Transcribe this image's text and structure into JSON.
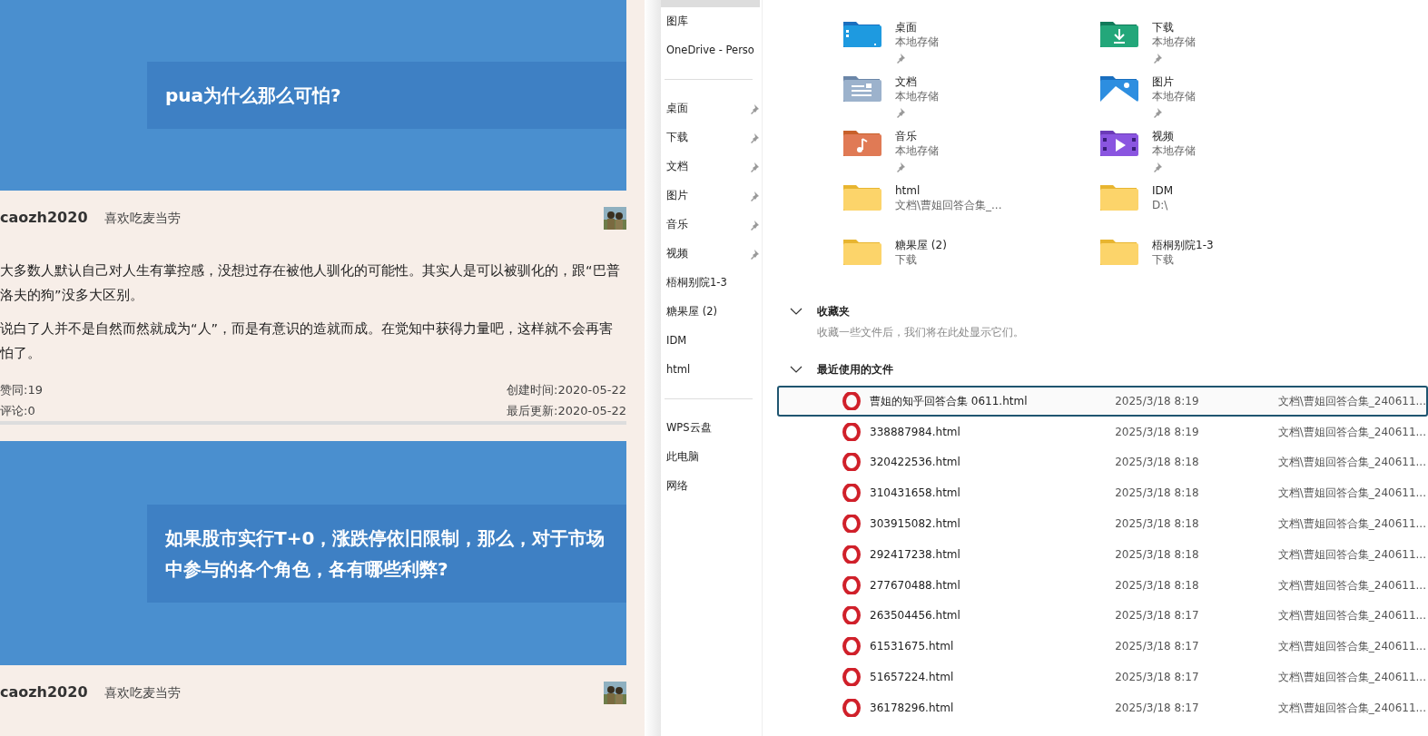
{
  "reader": {
    "posts": [
      {
        "question": "pua为什么那么可怕?",
        "author": {
          "name": "caozh2020",
          "signature": "喜欢吃麦当劳"
        },
        "paragraphs": [
          "大多数人默认自己对人生有掌控感，没想过存在被他人驯化的可能性。其实人是可以被驯化的，跟“巴普洛夫的狗”没多大区别。",
          "说白了人并不是自然而然就成为“人”，而是有意识的造就而成。在觉知中获得力量吧，这样就不会再害怕了。"
        ],
        "likes": "赞同:19",
        "comments": "评论:0",
        "created": "创建时间:2020-05-22",
        "updated": "最后更新:2020-05-22"
      },
      {
        "question": "如果股市实行T+0，涨跌停依旧限制，那么，对于市场中参与的各个角色，各有哪些利弊?",
        "author": {
          "name": "caozh2020",
          "signature": "喜欢吃麦当劳"
        }
      }
    ]
  },
  "explorer": {
    "sidebar": {
      "groups": [
        [
          {
            "label": "图库",
            "pinned": false
          },
          {
            "label": "OneDrive - Perso",
            "pinned": false
          }
        ],
        [
          {
            "label": "桌面",
            "pinned": true
          },
          {
            "label": "下载",
            "pinned": true
          },
          {
            "label": "文档",
            "pinned": true
          },
          {
            "label": "图片",
            "pinned": true
          },
          {
            "label": "音乐",
            "pinned": true
          },
          {
            "label": "视频",
            "pinned": true
          },
          {
            "label": "梧桐别院1-3",
            "pinned": false
          },
          {
            "label": "糖果屋 (2)",
            "pinned": false
          },
          {
            "label": "IDM",
            "pinned": false
          },
          {
            "label": "html",
            "pinned": false
          }
        ],
        [
          {
            "label": "WPS云盘",
            "pinned": false
          },
          {
            "label": "此电脑",
            "pinned": false
          },
          {
            "label": "网络",
            "pinned": false
          }
        ]
      ]
    },
    "quick_access": [
      {
        "kind": "desktop",
        "name": "桌面",
        "location": "本地存储",
        "pinned": true
      },
      {
        "kind": "downloads",
        "name": "下载",
        "location": "本地存储",
        "pinned": true
      },
      {
        "kind": "documents",
        "name": "文档",
        "location": "本地存储",
        "pinned": true
      },
      {
        "kind": "pictures",
        "name": "图片",
        "location": "本地存储",
        "pinned": true
      },
      {
        "kind": "music",
        "name": "音乐",
        "location": "本地存储",
        "pinned": true
      },
      {
        "kind": "videos",
        "name": "视频",
        "location": "本地存储",
        "pinned": true
      },
      {
        "kind": "folder",
        "name": "html",
        "location": "文档\\曹姐回答合集_...",
        "pinned": false
      },
      {
        "kind": "folder",
        "name": "IDM",
        "location": "D:\\",
        "pinned": false
      },
      {
        "kind": "folder",
        "name": "糖果屋 (2)",
        "location": "下载",
        "pinned": false
      },
      {
        "kind": "folder",
        "name": "梧桐别院1-3",
        "location": "下载",
        "pinned": false
      }
    ],
    "favorites": {
      "title": "收藏夹",
      "expanded": true,
      "hint": "收藏一些文件后，我们将在此处显示它们。"
    },
    "recent": {
      "title": "最近使用的文件",
      "expanded": true,
      "files": [
        {
          "name": "曹姐的知乎回答合集 0611.html",
          "date": "2025/3/18 8:19",
          "location": "文档\\曹姐回答合集_240611...",
          "selected": true
        },
        {
          "name": "338887984.html",
          "date": "2025/3/18 8:19",
          "location": "文档\\曹姐回答合集_240611...",
          "selected": false
        },
        {
          "name": "320422536.html",
          "date": "2025/3/18 8:18",
          "location": "文档\\曹姐回答合集_240611...",
          "selected": false
        },
        {
          "name": "310431658.html",
          "date": "2025/3/18 8:18",
          "location": "文档\\曹姐回答合集_240611...",
          "selected": false
        },
        {
          "name": "303915082.html",
          "date": "2025/3/18 8:18",
          "location": "文档\\曹姐回答合集_240611...",
          "selected": false
        },
        {
          "name": "292417238.html",
          "date": "2025/3/18 8:18",
          "location": "文档\\曹姐回答合集_240611...",
          "selected": false
        },
        {
          "name": "277670488.html",
          "date": "2025/3/18 8:18",
          "location": "文档\\曹姐回答合集_240611...",
          "selected": false
        },
        {
          "name": "263504456.html",
          "date": "2025/3/18 8:17",
          "location": "文档\\曹姐回答合集_240611...",
          "selected": false
        },
        {
          "name": "61531675.html",
          "date": "2025/3/18 8:17",
          "location": "文档\\曹姐回答合集_240611...",
          "selected": false
        },
        {
          "name": "51657224.html",
          "date": "2025/3/18 8:17",
          "location": "文档\\曹姐回答合集_240611...",
          "selected": false
        },
        {
          "name": "36178296.html",
          "date": "2025/3/18 8:17",
          "location": "文档\\曹姐回答合集_240611...",
          "selected": false
        }
      ]
    }
  }
}
